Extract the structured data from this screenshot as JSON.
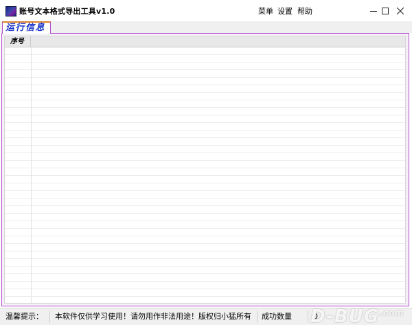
{
  "window": {
    "title": "账号文本格式导出工具v1.0"
  },
  "menu": {
    "items": [
      "菜单",
      "设置",
      "帮助"
    ]
  },
  "tabs": [
    {
      "label": "运行信息",
      "active": true
    }
  ],
  "grid": {
    "columns": [
      "序号"
    ],
    "rows": []
  },
  "status": {
    "hint_label": "温馨提示：",
    "notice": "本软件仅供学习使用！请勿用作非法用途！版权归小猛所有",
    "success_label": "成功数量",
    "success_value": "0"
  },
  "watermark": {
    "text": "D-BUG",
    "suffix": ".com"
  },
  "colors": {
    "panel_border": "#b24bd0",
    "tab_text": "#1a35c8",
    "tab_top_accent": "#e0802c"
  }
}
